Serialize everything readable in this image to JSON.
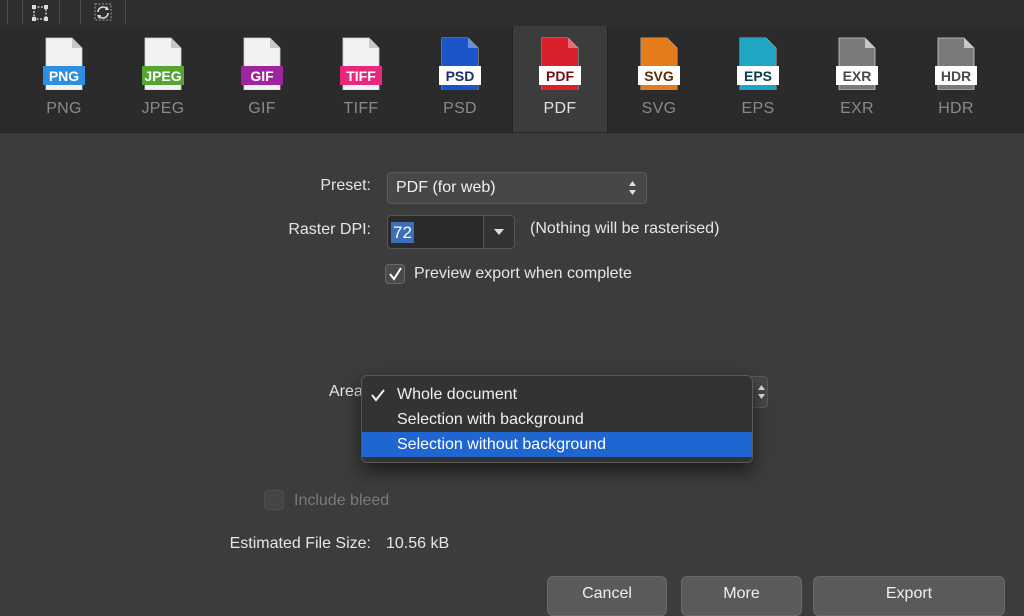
{
  "formats": [
    {
      "name": "PNG",
      "color": "#2f8ee0"
    },
    {
      "name": "JPEG",
      "color": "#55a532"
    },
    {
      "name": "GIF",
      "color": "#a0249e"
    },
    {
      "name": "TIFF",
      "color": "#e8287e"
    },
    {
      "name": "PSD",
      "color": "#1a56c7"
    },
    {
      "name": "PDF",
      "color": "#d9202b"
    },
    {
      "name": "SVG",
      "color": "#e47b1c"
    },
    {
      "name": "EPS",
      "color": "#1fa6c4"
    },
    {
      "name": "EXR",
      "color": "#5a5a5a"
    },
    {
      "name": "HDR",
      "color": "#6e6e6e"
    }
  ],
  "selected_format": "PDF",
  "preset": {
    "label": "Preset:",
    "value": "PDF (for web)"
  },
  "raster_dpi": {
    "label": "Raster DPI:",
    "value": "72",
    "hint": "(Nothing will be rasterised)"
  },
  "preview": {
    "label": "Preview export when complete",
    "checked": true
  },
  "area": {
    "label": "Area",
    "options": [
      "Whole document",
      "Selection with background",
      "Selection without background"
    ],
    "checked_option": "Whole document",
    "highlighted_option": "Selection without background"
  },
  "include_bleed": {
    "label": "Include bleed",
    "enabled": false
  },
  "file_size": {
    "label": "Estimated File Size:",
    "value": "10.56 kB"
  },
  "buttons": {
    "cancel": "Cancel",
    "more": "More",
    "export": "Export"
  },
  "colors": {
    "highlight": "#1f66d1",
    "accent_check": "#ffffff"
  }
}
